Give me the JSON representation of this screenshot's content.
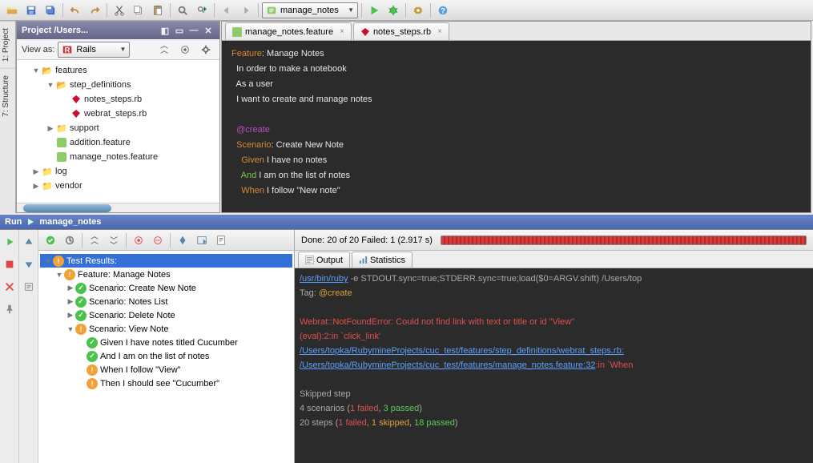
{
  "toolbar": {
    "run_config": "manage_notes"
  },
  "project_panel": {
    "title": "Project /Users...",
    "view_label": "View as:",
    "view_combo": "Rails",
    "tree": {
      "features": "features",
      "step_definitions": "step_definitions",
      "notes_steps": "notes_steps.rb",
      "webrat_steps": "webrat_steps.rb",
      "support": "support",
      "addition": "addition.feature",
      "manage_notes": "manage_notes.feature",
      "log": "log",
      "vendor": "vendor"
    }
  },
  "side_tabs": {
    "project": "1: Project",
    "structure": "7: Structure"
  },
  "editor": {
    "tabs": {
      "t1": "manage_notes.feature",
      "t2": "notes_steps.rb"
    },
    "lines": {
      "l1_kw": "Feature",
      "l1_txt": ": Manage Notes",
      "l2": "  In order to make a notebook",
      "l3": "  As a user",
      "l4": "  I want to create and manage notes",
      "l5": "",
      "l6": "  @create",
      "l7_kw": "  Scenario",
      "l7_txt": ": Create New Note",
      "l8_kw": "    Given",
      "l8_txt": " I have no notes",
      "l9_kw": "    And",
      "l9_txt": " I am on the list of notes",
      "l10_kw": "    When",
      "l10_txt": " I follow \"New note\""
    }
  },
  "run": {
    "header_label": "Run",
    "header_name": "manage_notes",
    "done": "Done: 20 of 20  Failed: 1  (2.917 s)",
    "output_tab": "Output",
    "stats_tab": "Statistics",
    "tree": {
      "root": "Test Results:",
      "feature": "Feature: Manage Notes",
      "s1": "Scenario: Create New Note",
      "s2": "Scenario: Notes List",
      "s3": "Scenario: Delete Note",
      "s4": "Scenario: View Note",
      "st1": "Given I have notes titled Cucumber",
      "st2": "And I am on the list of notes",
      "st3": "When I follow \"View\"",
      "st4": "Then I should see \"Cucumber\""
    },
    "console": {
      "c1a": "/usr/bin/ruby",
      "c1b": " -e STDOUT.sync=true;STDERR.sync=true;load($0=ARGV.shift) /Users/top",
      "c2a": "Tag: ",
      "c2b": "@create",
      "c3": "",
      "c4": "Webrat::NotFoundError: Could not find link with text or title or id \"View\"",
      "c5": "(eval):2:in `click_link'",
      "c6": "/Users/topka/RubymineProjects/cuc_test/features/step_definitions/webrat_steps.rb:",
      "c7a": "/Users/topka/RubymineProjects/cuc_test/features/manage_notes.feature:32",
      "c7b": ":in `When ",
      "c8": "",
      "c9": "Skipped step",
      "c10a": "4 scenarios (",
      "c10b": "1 failed",
      "c10c": ", ",
      "c10d": "3 passed",
      "c10e": ")",
      "c11a": "20 steps (",
      "c11b": "1 failed",
      "c11c": ", ",
      "c11d": "1 skipped",
      "c11e": ", ",
      "c11f": "18 passed",
      "c11g": ")"
    }
  }
}
